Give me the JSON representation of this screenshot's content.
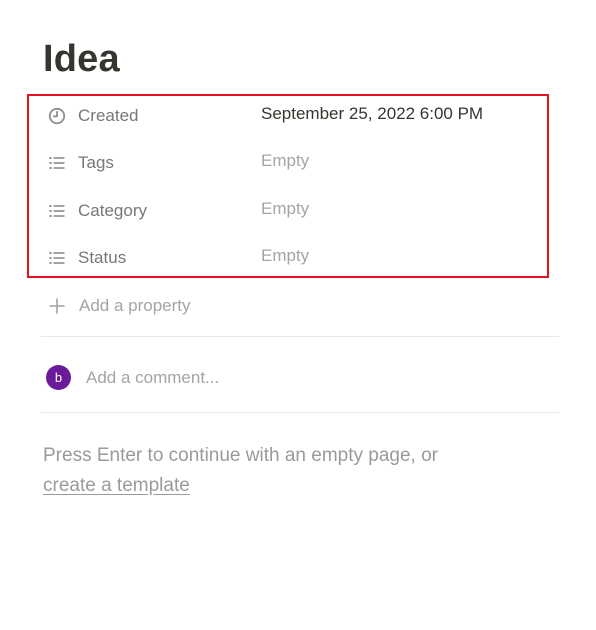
{
  "page": {
    "title": "Idea"
  },
  "properties": [
    {
      "icon": "clock-icon",
      "name": "Created",
      "value": "September 25, 2022 6:00 PM"
    },
    {
      "icon": "list-icon",
      "name": "Tags",
      "value": "Empty"
    },
    {
      "icon": "list-icon",
      "name": "Category",
      "value": "Empty"
    },
    {
      "icon": "list-icon",
      "name": "Status",
      "value": "Empty"
    }
  ],
  "add_property": {
    "icon": "plus-icon",
    "label": "Add a property"
  },
  "comment": {
    "avatar_initial": "b",
    "avatar_color": "#6a1b9a",
    "placeholder": "Add a comment..."
  },
  "hint": {
    "text": "Press Enter to continue with an empty page, or",
    "link": "create a template"
  },
  "colors": {
    "highlight": "#e0141e",
    "text": "#37352f",
    "muted": "#a5a4a0"
  }
}
